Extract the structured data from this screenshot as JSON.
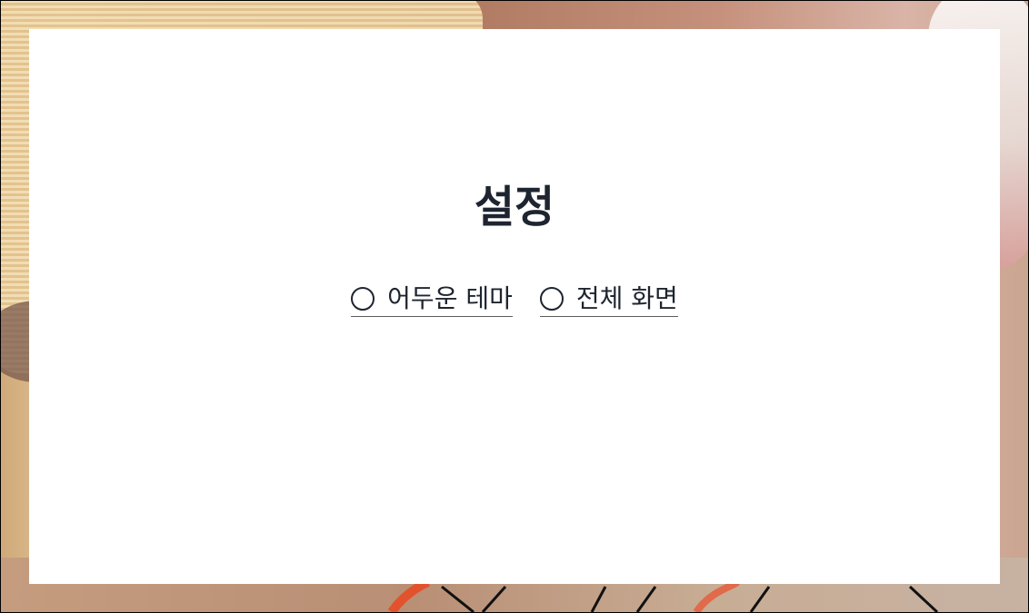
{
  "settings": {
    "title": "설정",
    "options": [
      {
        "label": "어두운 테마",
        "checked": false
      },
      {
        "label": "전체 화면",
        "checked": false
      }
    ]
  },
  "colors": {
    "panel_background": "#ffffff",
    "text": "#1e2530",
    "underline": "#5c5c5c"
  }
}
